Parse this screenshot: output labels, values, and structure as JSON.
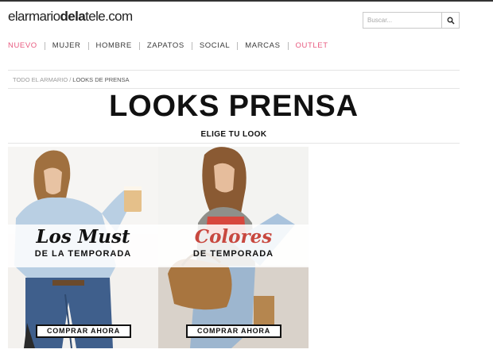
{
  "header": {
    "logo_part1": "elarmario",
    "logo_part2": "dela",
    "logo_part3": "tele",
    "logo_part4": ".com",
    "search_placeholder": "Buscar...",
    "search_icon": "search-icon"
  },
  "nav": {
    "items": [
      {
        "label": "NUEVO",
        "color": "#e85a7f"
      },
      {
        "label": "MUJER"
      },
      {
        "label": "HOMBRE"
      },
      {
        "label": "ZAPATOS"
      },
      {
        "label": "SOCIAL"
      },
      {
        "label": "MARCAS"
      },
      {
        "label": "OUTLET",
        "color": "#e85a7f"
      }
    ]
  },
  "breadcrumb": {
    "parent": "TODO EL ARMARIO",
    "separator": "/",
    "current": "LOOKS DE PRENSA"
  },
  "main": {
    "title": "LOOKS PRENSA",
    "subtitle": "ELIGE TU LOOK"
  },
  "cards": [
    {
      "script_title": "Los Must",
      "subtitle": "DE LA TEMPORADA",
      "cta": "COMPRAR AHORA",
      "accent": "#111111"
    },
    {
      "script_title": "Colores",
      "subtitle": "DE TEMPORADA",
      "cta": "COMPRAR AHORA",
      "accent": "#c8483f"
    }
  ]
}
